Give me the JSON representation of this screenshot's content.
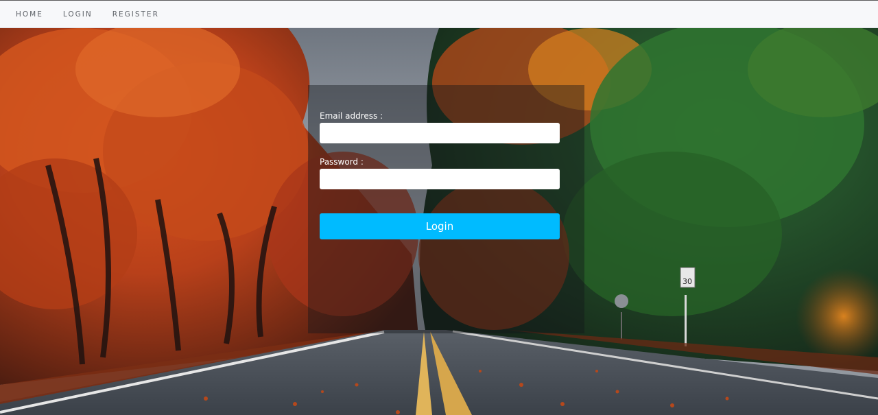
{
  "nav": {
    "items": [
      {
        "label": "HOME"
      },
      {
        "label": "LOGIN"
      },
      {
        "label": "REGISTER"
      }
    ]
  },
  "login_form": {
    "email_label": "Email address :",
    "email_value": "",
    "password_label": "Password :",
    "password_value": "",
    "submit_label": "Login"
  },
  "background": {
    "subject": "autumn forest road",
    "sign_text": "30"
  },
  "colors": {
    "navbar_bg": "#f7f8fa",
    "nav_text": "#5d6167",
    "button_bg": "#00bbff",
    "button_text": "#ffffff",
    "label_text": "#ffffff"
  }
}
